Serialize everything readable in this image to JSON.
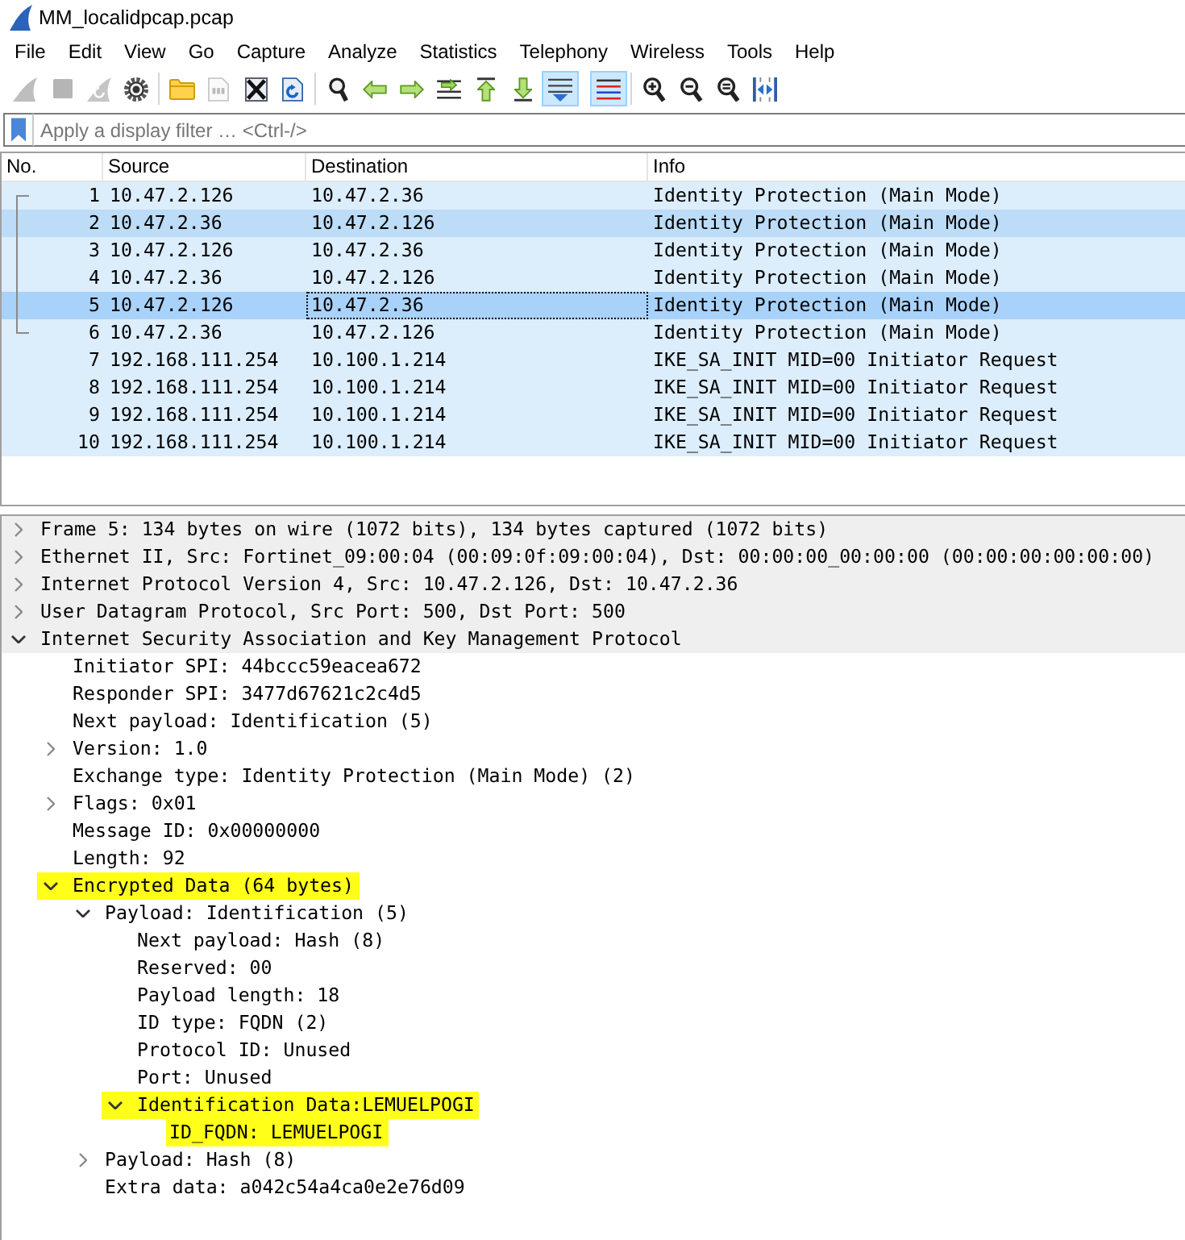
{
  "window": {
    "title": "MM_localidpcap.pcap"
  },
  "menu": [
    "File",
    "Edit",
    "View",
    "Go",
    "Capture",
    "Analyze",
    "Statistics",
    "Telephony",
    "Wireless",
    "Tools",
    "Help"
  ],
  "toolbar": [
    {
      "kind": "start",
      "disabled": true,
      "pressed": false
    },
    {
      "kind": "stop",
      "disabled": true,
      "pressed": false
    },
    {
      "kind": "restart",
      "disabled": true,
      "pressed": false
    },
    {
      "kind": "options",
      "disabled": false,
      "pressed": false
    },
    {
      "kind": "separator"
    },
    {
      "kind": "open",
      "disabled": false,
      "pressed": false
    },
    {
      "kind": "save",
      "disabled": true,
      "pressed": false
    },
    {
      "kind": "close",
      "disabled": false,
      "pressed": false
    },
    {
      "kind": "reload",
      "disabled": false,
      "pressed": false
    },
    {
      "kind": "separator"
    },
    {
      "kind": "find",
      "disabled": false,
      "pressed": false
    },
    {
      "kind": "back",
      "disabled": false,
      "pressed": false
    },
    {
      "kind": "forward",
      "disabled": false,
      "pressed": false
    },
    {
      "kind": "goto",
      "disabled": false,
      "pressed": false
    },
    {
      "kind": "first",
      "disabled": false,
      "pressed": false
    },
    {
      "kind": "last",
      "disabled": false,
      "pressed": false
    },
    {
      "kind": "autoscroll",
      "disabled": false,
      "pressed": true
    },
    {
      "kind": "colorize",
      "disabled": false,
      "pressed": true
    },
    {
      "kind": "separator"
    },
    {
      "kind": "zoomin",
      "disabled": false,
      "pressed": false
    },
    {
      "kind": "zoomout",
      "disabled": false,
      "pressed": false
    },
    {
      "kind": "zoomreset",
      "disabled": false,
      "pressed": false
    },
    {
      "kind": "resize",
      "disabled": false,
      "pressed": false
    }
  ],
  "display_filter": {
    "placeholder": "Apply a display filter … <Ctrl-/>"
  },
  "packet_list": {
    "columns": [
      "No.",
      "Source",
      "Destination",
      "Info"
    ],
    "rows": [
      {
        "no": "1",
        "source": "10.47.2.126",
        "destination": "10.47.2.36",
        "info": "Identity Protection (Main Mode)",
        "selected": false,
        "hovered": false,
        "focused": false,
        "related": true
      },
      {
        "no": "2",
        "source": "10.47.2.36",
        "destination": "10.47.2.126",
        "info": "Identity Protection (Main Mode)",
        "selected": false,
        "hovered": true,
        "focused": false,
        "related": true
      },
      {
        "no": "3",
        "source": "10.47.2.126",
        "destination": "10.47.2.36",
        "info": "Identity Protection (Main Mode)",
        "selected": false,
        "hovered": false,
        "focused": false,
        "related": true
      },
      {
        "no": "4",
        "source": "10.47.2.36",
        "destination": "10.47.2.126",
        "info": "Identity Protection (Main Mode)",
        "selected": false,
        "hovered": false,
        "focused": false,
        "related": true
      },
      {
        "no": "5",
        "source": "10.47.2.126",
        "destination": "10.47.2.36",
        "info": "Identity Protection (Main Mode)",
        "selected": true,
        "hovered": false,
        "focused": true,
        "related": true
      },
      {
        "no": "6",
        "source": "10.47.2.36",
        "destination": "10.47.2.126",
        "info": "Identity Protection (Main Mode)",
        "selected": false,
        "hovered": false,
        "focused": false,
        "related": true
      },
      {
        "no": "7",
        "source": "192.168.111.254",
        "destination": "10.100.1.214",
        "info": "IKE_SA_INIT MID=00 Initiator Request",
        "selected": false,
        "hovered": false,
        "focused": false,
        "related": false
      },
      {
        "no": "8",
        "source": "192.168.111.254",
        "destination": "10.100.1.214",
        "info": "IKE_SA_INIT MID=00 Initiator Request",
        "selected": false,
        "hovered": false,
        "focused": false,
        "related": false
      },
      {
        "no": "9",
        "source": "192.168.111.254",
        "destination": "10.100.1.214",
        "info": "IKE_SA_INIT MID=00 Initiator Request",
        "selected": false,
        "hovered": false,
        "focused": false,
        "related": false
      },
      {
        "no": "10",
        "source": "192.168.111.254",
        "destination": "10.100.1.214",
        "info": "IKE_SA_INIT MID=00 Initiator Request",
        "selected": false,
        "hovered": false,
        "focused": false,
        "related": false
      }
    ]
  },
  "packet_details": [
    {
      "kind": "branch",
      "label": "Frame 5: 134 bytes on wire (1072 bits), 134 bytes captured (1072 bits)",
      "expanded": false,
      "highlighted": false
    },
    {
      "kind": "branch",
      "label": "Ethernet II, Src: Fortinet_09:00:04 (00:09:0f:09:00:04), Dst: 00:00:00_00:00:00 (00:00:00:00:00:00)",
      "expanded": false,
      "highlighted": false
    },
    {
      "kind": "branch",
      "label": "Internet Protocol Version 4, Src: 10.47.2.126, Dst: 10.47.2.36",
      "expanded": false,
      "highlighted": false
    },
    {
      "kind": "branch",
      "label": "User Datagram Protocol, Src Port: 500, Dst Port: 500",
      "expanded": false,
      "highlighted": false
    },
    {
      "kind": "branch",
      "label": "Internet Security Association and Key Management Protocol",
      "expanded": true,
      "highlighted": false,
      "children": [
        {
          "kind": "leaf",
          "label": "Initiator SPI: 44bccc59eacea672",
          "highlighted": false
        },
        {
          "kind": "leaf",
          "label": "Responder SPI: 3477d67621c2c4d5",
          "highlighted": false
        },
        {
          "kind": "leaf",
          "label": "Next payload: Identification (5)",
          "highlighted": false
        },
        {
          "kind": "branch",
          "label": "Version: 1.0",
          "expanded": false,
          "highlighted": false
        },
        {
          "kind": "leaf",
          "label": "Exchange type: Identity Protection (Main Mode) (2)",
          "highlighted": false
        },
        {
          "kind": "branch",
          "label": "Flags: 0x01",
          "expanded": false,
          "highlighted": false
        },
        {
          "kind": "leaf",
          "label": "Message ID: 0x00000000",
          "highlighted": false
        },
        {
          "kind": "leaf",
          "label": "Length: 92",
          "highlighted": false
        },
        {
          "kind": "branch",
          "label": "Encrypted Data (64 bytes)",
          "expanded": true,
          "highlighted": true,
          "children": [
            {
              "kind": "branch",
              "label": "Payload: Identification (5)",
              "expanded": true,
              "highlighted": false,
              "children": [
                {
                  "kind": "leaf",
                  "label": "Next payload: Hash (8)",
                  "highlighted": false
                },
                {
                  "kind": "leaf",
                  "label": "Reserved: 00",
                  "highlighted": false
                },
                {
                  "kind": "leaf",
                  "label": "Payload length: 18",
                  "highlighted": false
                },
                {
                  "kind": "leaf",
                  "label": "ID type: FQDN (2)",
                  "highlighted": false
                },
                {
                  "kind": "leaf",
                  "label": "Protocol ID: Unused",
                  "highlighted": false
                },
                {
                  "kind": "leaf",
                  "label": "Port: Unused",
                  "highlighted": false
                },
                {
                  "kind": "branch",
                  "label": "Identification Data:LEMUELPOGI",
                  "expanded": true,
                  "highlighted": true,
                  "children": [
                    {
                      "kind": "leaf",
                      "label": "ID_FQDN: LEMUELPOGI",
                      "highlighted": true
                    }
                  ]
                }
              ]
            },
            {
              "kind": "branch",
              "label": "Payload: Hash (8)",
              "expanded": false,
              "highlighted": false
            },
            {
              "kind": "leaf",
              "label": "Extra data: a042c54a4ca0e2e76d09",
              "highlighted": false
            }
          ]
        }
      ]
    }
  ]
}
